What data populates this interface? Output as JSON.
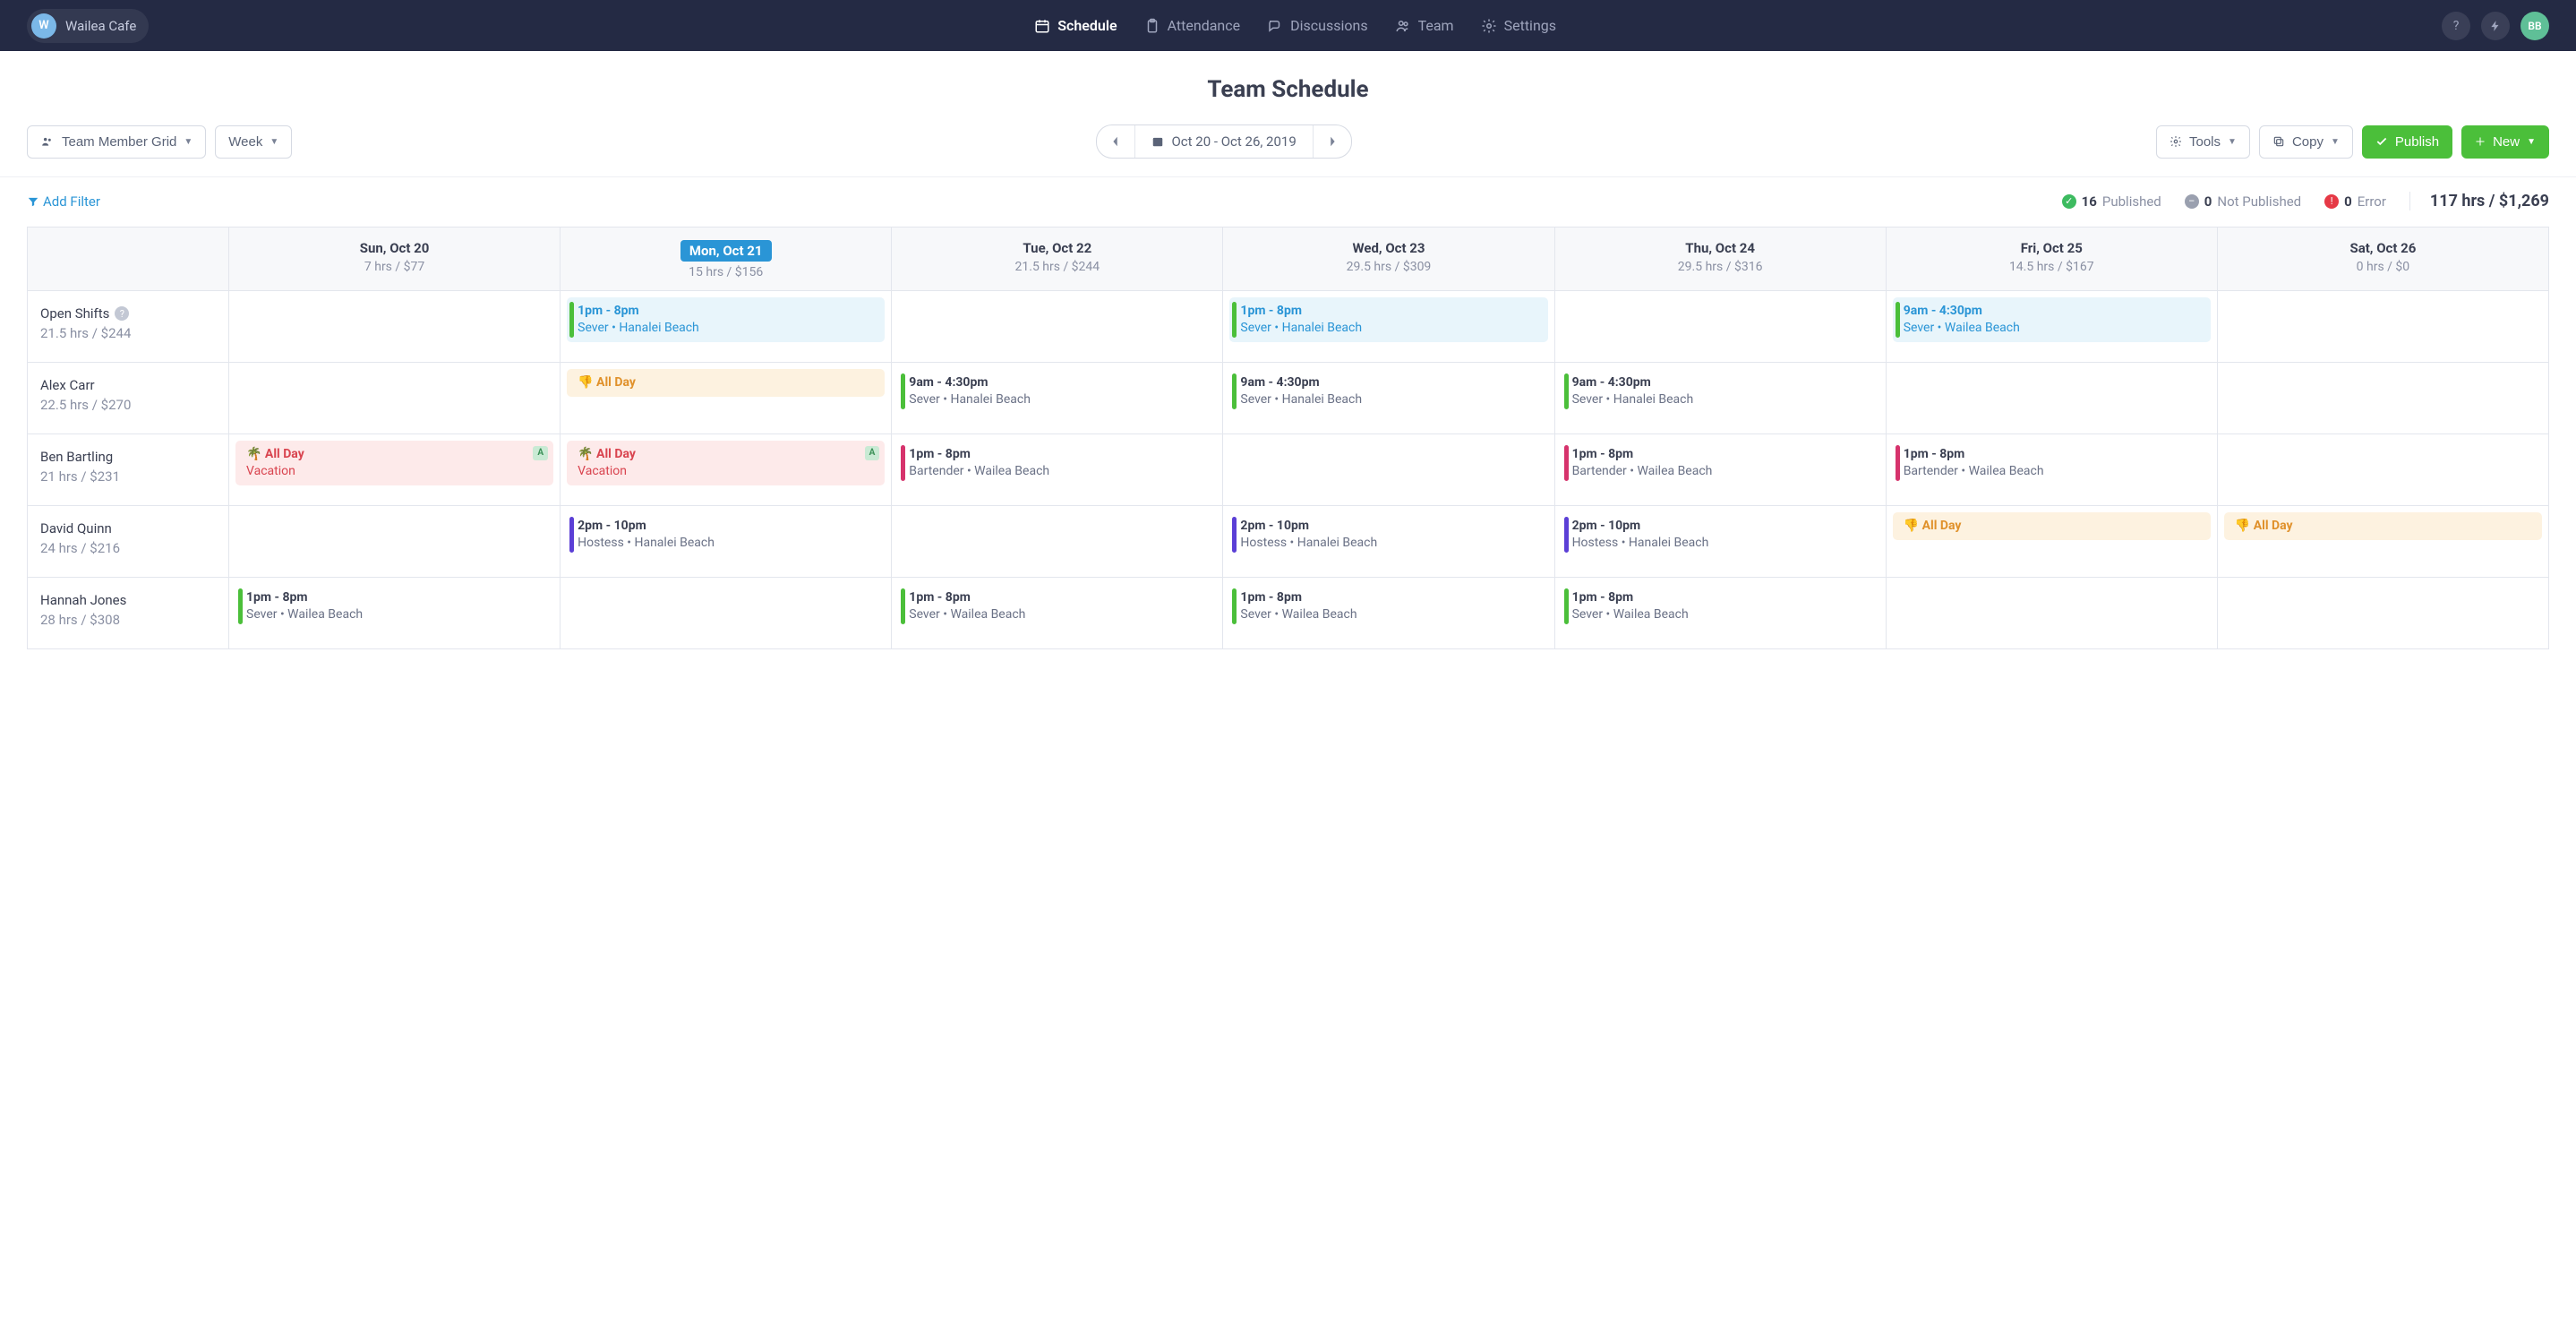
{
  "org": {
    "initial": "W",
    "name": "Wailea Cafe"
  },
  "nav": {
    "schedule": "Schedule",
    "attendance": "Attendance",
    "discussions": "Discussions",
    "team": "Team",
    "settings": "Settings"
  },
  "user": {
    "initials": "BB"
  },
  "page_title": "Team Schedule",
  "toolbar": {
    "view_grid": "Team Member Grid",
    "period": "Week",
    "date_range": "Oct 20 - Oct 26, 2019",
    "tools": "Tools",
    "copy": "Copy",
    "publish": "Publish",
    "new": "New"
  },
  "filter": {
    "add": "Add Filter"
  },
  "status": {
    "published_n": "16",
    "published_l": "Published",
    "notpub_n": "0",
    "notpub_l": "Not Published",
    "error_n": "0",
    "error_l": "Error",
    "totals": "117 hrs / $1,269"
  },
  "days": [
    {
      "label": "Sun, Oct 20",
      "sub": "7 hrs / $77",
      "today": false
    },
    {
      "label": "Mon, Oct 21",
      "sub": "15 hrs / $156",
      "today": true
    },
    {
      "label": "Tue, Oct 22",
      "sub": "21.5 hrs / $244",
      "today": false
    },
    {
      "label": "Wed, Oct 23",
      "sub": "29.5 hrs / $309",
      "today": false
    },
    {
      "label": "Thu, Oct 24",
      "sub": "29.5 hrs / $316",
      "today": false
    },
    {
      "label": "Fri, Oct 25",
      "sub": "14.5 hrs / $167",
      "today": false
    },
    {
      "label": "Sat, Oct 26",
      "sub": "0 hrs / $0",
      "today": false
    }
  ],
  "rows": [
    {
      "name": "Open Shifts",
      "sub": "21.5 hrs / $244",
      "open": true,
      "cells": [
        null,
        {
          "type": "open",
          "time": "1pm - 8pm",
          "detail": "Sever • Hanalei Beach"
        },
        null,
        {
          "type": "open",
          "time": "1pm - 8pm",
          "detail": "Sever • Hanalei Beach"
        },
        null,
        {
          "type": "open",
          "time": "9am - 4:30pm",
          "detail": "Sever • Wailea Beach"
        },
        null
      ]
    },
    {
      "name": "Alex Carr",
      "sub": "22.5 hrs / $270",
      "cells": [
        null,
        {
          "type": "busy",
          "time": "All Day"
        },
        {
          "type": "plain",
          "bar": "green",
          "time": "9am - 4:30pm",
          "detail": "Sever • Hanalei Beach"
        },
        {
          "type": "plain",
          "bar": "green",
          "time": "9am - 4:30pm",
          "detail": "Sever • Hanalei Beach"
        },
        {
          "type": "plain",
          "bar": "green",
          "time": "9am - 4:30pm",
          "detail": "Sever • Hanalei Beach"
        },
        null,
        null
      ]
    },
    {
      "name": "Ben Bartling",
      "sub": "21 hrs / $231",
      "cells": [
        {
          "type": "timeoff",
          "time": "All Day",
          "detail": "Vacation",
          "badge": "A"
        },
        {
          "type": "timeoff",
          "time": "All Day",
          "detail": "Vacation",
          "badge": "A"
        },
        {
          "type": "plain",
          "bar": "pink",
          "time": "1pm - 8pm",
          "detail": "Bartender • Wailea Beach"
        },
        null,
        {
          "type": "plain",
          "bar": "pink",
          "time": "1pm - 8pm",
          "detail": "Bartender • Wailea Beach"
        },
        {
          "type": "plain",
          "bar": "pink",
          "time": "1pm - 8pm",
          "detail": "Bartender • Wailea Beach"
        },
        null
      ]
    },
    {
      "name": "David Quinn",
      "sub": "24 hrs / $216",
      "cells": [
        null,
        {
          "type": "plain",
          "bar": "purple",
          "time": "2pm - 10pm",
          "detail": "Hostess • Hanalei Beach"
        },
        null,
        {
          "type": "plain",
          "bar": "purple",
          "time": "2pm - 10pm",
          "detail": "Hostess • Hanalei Beach"
        },
        {
          "type": "plain",
          "bar": "purple",
          "time": "2pm - 10pm",
          "detail": "Hostess • Hanalei Beach"
        },
        {
          "type": "busy",
          "time": "All Day"
        },
        {
          "type": "busy",
          "time": "All Day"
        }
      ]
    },
    {
      "name": "Hannah Jones",
      "sub": "28 hrs / $308",
      "cells": [
        {
          "type": "plain",
          "bar": "green",
          "time": "1pm - 8pm",
          "detail": "Sever • Wailea Beach"
        },
        null,
        {
          "type": "plain",
          "bar": "green",
          "time": "1pm - 8pm",
          "detail": "Sever • Wailea Beach"
        },
        {
          "type": "plain",
          "bar": "green",
          "time": "1pm - 8pm",
          "detail": "Sever • Wailea Beach"
        },
        {
          "type": "plain",
          "bar": "green",
          "time": "1pm - 8pm",
          "detail": "Sever • Wailea Beach"
        },
        null,
        null
      ]
    }
  ]
}
